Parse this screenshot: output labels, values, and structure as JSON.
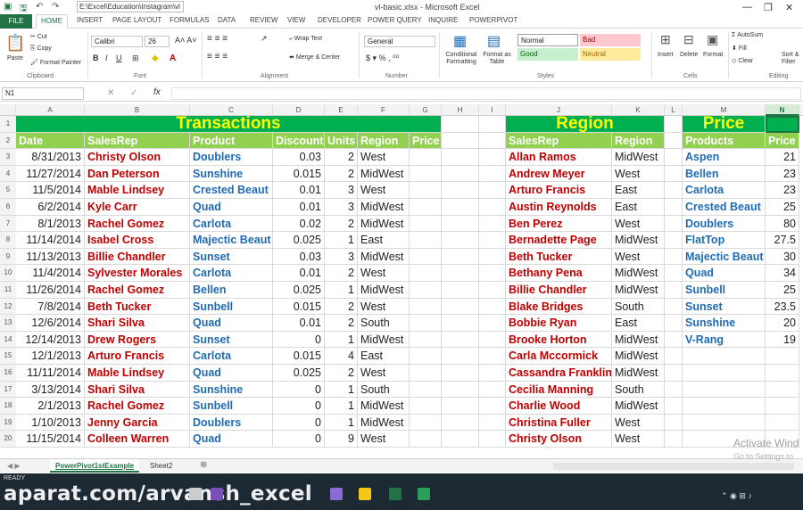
{
  "window": {
    "path": "E:\\Excel\\Education\\Instagram\\vl",
    "title": "vl-basic.xlsx - Microsoft Excel"
  },
  "tabs": [
    "FILE",
    "HOME",
    "INSERT",
    "PAGE LAYOUT",
    "FORMULAS",
    "DATA",
    "REVIEW",
    "VIEW",
    "DEVELOPER",
    "POWER QUERY",
    "INQUIRE",
    "POWERPIVOT"
  ],
  "ribbon": {
    "cut": "Cut",
    "copy": "Copy",
    "format_painter": "Format Painter",
    "paste": "Paste",
    "clipboard": "Clipboard",
    "font_name": "Calibri",
    "font_size": "26",
    "font": "Font",
    "wrap_text": "Wrap Text",
    "merge_center": "Merge & Center",
    "alignment": "Alignment",
    "number_format": "General",
    "number": "Number",
    "conditional": "Conditional Formatting",
    "format_table": "Format as Table",
    "normal": "Normal",
    "bad": "Bad",
    "good": "Good",
    "neutral": "Neutral",
    "styles": "Styles",
    "insert": "Insert",
    "delete": "Delete",
    "format": "Format",
    "cells": "Cells",
    "autosum": "AutoSum",
    "fill": "Fill",
    "clear": "Clear",
    "sort": "Sort & Filter",
    "editing": "Editing"
  },
  "namebox": "N1",
  "columns": [
    "A",
    "B",
    "C",
    "D",
    "E",
    "F",
    "G",
    "H",
    "I",
    "J",
    "K",
    "L",
    "M",
    "N"
  ],
  "rows": [
    "1",
    "2",
    "3",
    "4",
    "5",
    "6",
    "7",
    "8",
    "9",
    "10",
    "11",
    "12",
    "13",
    "14",
    "15",
    "16",
    "17",
    "18",
    "19",
    "20"
  ],
  "transactions": {
    "title": "Transactions",
    "headers": [
      "Date",
      "SalesRep",
      "Product",
      "Discount",
      "Units",
      "Region",
      "Price"
    ],
    "rows": [
      [
        "8/31/2013",
        "Christy  Olson",
        "Doublers",
        "0.03",
        "2",
        "West"
      ],
      [
        "11/27/2014",
        "Dan  Peterson",
        "Sunshine",
        "0.015",
        "2",
        "MidWest"
      ],
      [
        "11/5/2014",
        "Mable  Lindsey",
        "Crested Beaut",
        "0.01",
        "3",
        "West"
      ],
      [
        "6/2/2014",
        "Kyle  Carr",
        "Quad",
        "0.01",
        "3",
        "MidWest"
      ],
      [
        "8/1/2013",
        "Rachel  Gomez",
        "Carlota",
        "0.02",
        "2",
        "MidWest"
      ],
      [
        "11/14/2014",
        "Isabel  Cross",
        "Majectic Beaut",
        "0.025",
        "1",
        "East"
      ],
      [
        "11/13/2013",
        "Billie  Chandler",
        "Sunset",
        "0.03",
        "3",
        "MidWest"
      ],
      [
        "11/4/2014",
        "Sylvester  Morales",
        "Carlota",
        "0.01",
        "2",
        "West"
      ],
      [
        "11/26/2014",
        "Rachel  Gomez",
        "Bellen",
        "0.025",
        "1",
        "MidWest"
      ],
      [
        "7/8/2014",
        "Beth  Tucker",
        "Sunbell",
        "0.015",
        "2",
        "West"
      ],
      [
        "12/6/2014",
        "Shari  Silva",
        "Quad",
        "0.01",
        "2",
        "South"
      ],
      [
        "12/14/2013",
        "Drew  Rogers",
        "Sunset",
        "0",
        "1",
        "MidWest"
      ],
      [
        "12/1/2013",
        "Arturo  Francis",
        "Carlota",
        "0.015",
        "4",
        "East"
      ],
      [
        "11/11/2014",
        "Mable  Lindsey",
        "Quad",
        "0.025",
        "2",
        "West"
      ],
      [
        "3/13/2014",
        "Shari  Silva",
        "Sunshine",
        "0",
        "1",
        "South"
      ],
      [
        "2/1/2013",
        "Rachel  Gomez",
        "Sunbell",
        "0",
        "1",
        "MidWest"
      ],
      [
        "1/10/2013",
        "Jenny  Garcia",
        "Doublers",
        "0",
        "1",
        "MidWest"
      ],
      [
        "11/15/2014",
        "Colleen  Warren",
        "Quad",
        "0",
        "9",
        "West"
      ]
    ]
  },
  "region": {
    "title": "Region",
    "headers": [
      "SalesRep",
      "Region"
    ],
    "rows": [
      [
        "Allan  Ramos",
        "MidWest"
      ],
      [
        "Andrew  Meyer",
        "West"
      ],
      [
        "Arturo  Francis",
        "East"
      ],
      [
        "Austin  Reynolds",
        "East"
      ],
      [
        "Ben  Perez",
        "West"
      ],
      [
        "Bernadette  Page",
        "MidWest"
      ],
      [
        "Beth  Tucker",
        "West"
      ],
      [
        "Bethany  Pena",
        "MidWest"
      ],
      [
        "Billie  Chandler",
        "MidWest"
      ],
      [
        "Blake  Bridges",
        "South"
      ],
      [
        "Bobbie  Ryan",
        "East"
      ],
      [
        "Brooke  Horton",
        "MidWest"
      ],
      [
        "Carla  Mccormick",
        "MidWest"
      ],
      [
        "Cassandra  Franklin",
        "MidWest"
      ],
      [
        "Cecilia  Manning",
        "South"
      ],
      [
        "Charlie  Wood",
        "MidWest"
      ],
      [
        "Christina  Fuller",
        "West"
      ],
      [
        "Christy  Olson",
        "West"
      ]
    ]
  },
  "price": {
    "title": "Price",
    "headers": [
      "Products",
      "Price"
    ],
    "rows": [
      [
        "Aspen",
        "21"
      ],
      [
        "Bellen",
        "23"
      ],
      [
        "Carlota",
        "23"
      ],
      [
        "Crested Beaut",
        "25"
      ],
      [
        "Doublers",
        "80"
      ],
      [
        "FlatTop",
        "27.5"
      ],
      [
        "Majectic Beaut",
        "30"
      ],
      [
        "Quad",
        "34"
      ],
      [
        "Sunbell",
        "25"
      ],
      [
        "Sunset",
        "23.5"
      ],
      [
        "Sunshine",
        "20"
      ],
      [
        "V-Rang",
        "19"
      ]
    ]
  },
  "sheets": [
    "PowerPivot1stExample",
    "Sheet2"
  ],
  "status": "READY",
  "watermark": "aparat.com/arvansh_excel",
  "activate": [
    "Activate Wind",
    "Go to Settings to"
  ]
}
